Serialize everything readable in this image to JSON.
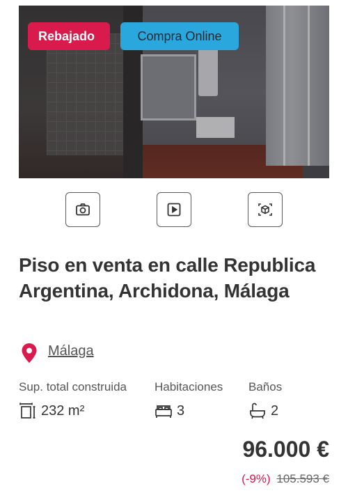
{
  "listing": {
    "badges": {
      "reduced": "Rebajado",
      "online": "Compra Online"
    },
    "media_buttons": [
      "camera-icon",
      "play-icon",
      "3d-tour-icon"
    ],
    "title": "Piso en venta en calle Republica Argentina, Archidona, Málaga",
    "location": "Málaga",
    "features": {
      "area_label": "Sup. total construida",
      "area_value": "232 m²",
      "rooms_label": "Habitaciones",
      "rooms_value": "3",
      "baths_label": "Baños",
      "baths_value": "2"
    },
    "price": "96.000 €",
    "discount_pct": "(-9%)",
    "old_price": "105.593 €"
  },
  "colors": {
    "accent": "#d81b4c",
    "online_badge": "#2aa8dd",
    "text": "#333333"
  }
}
